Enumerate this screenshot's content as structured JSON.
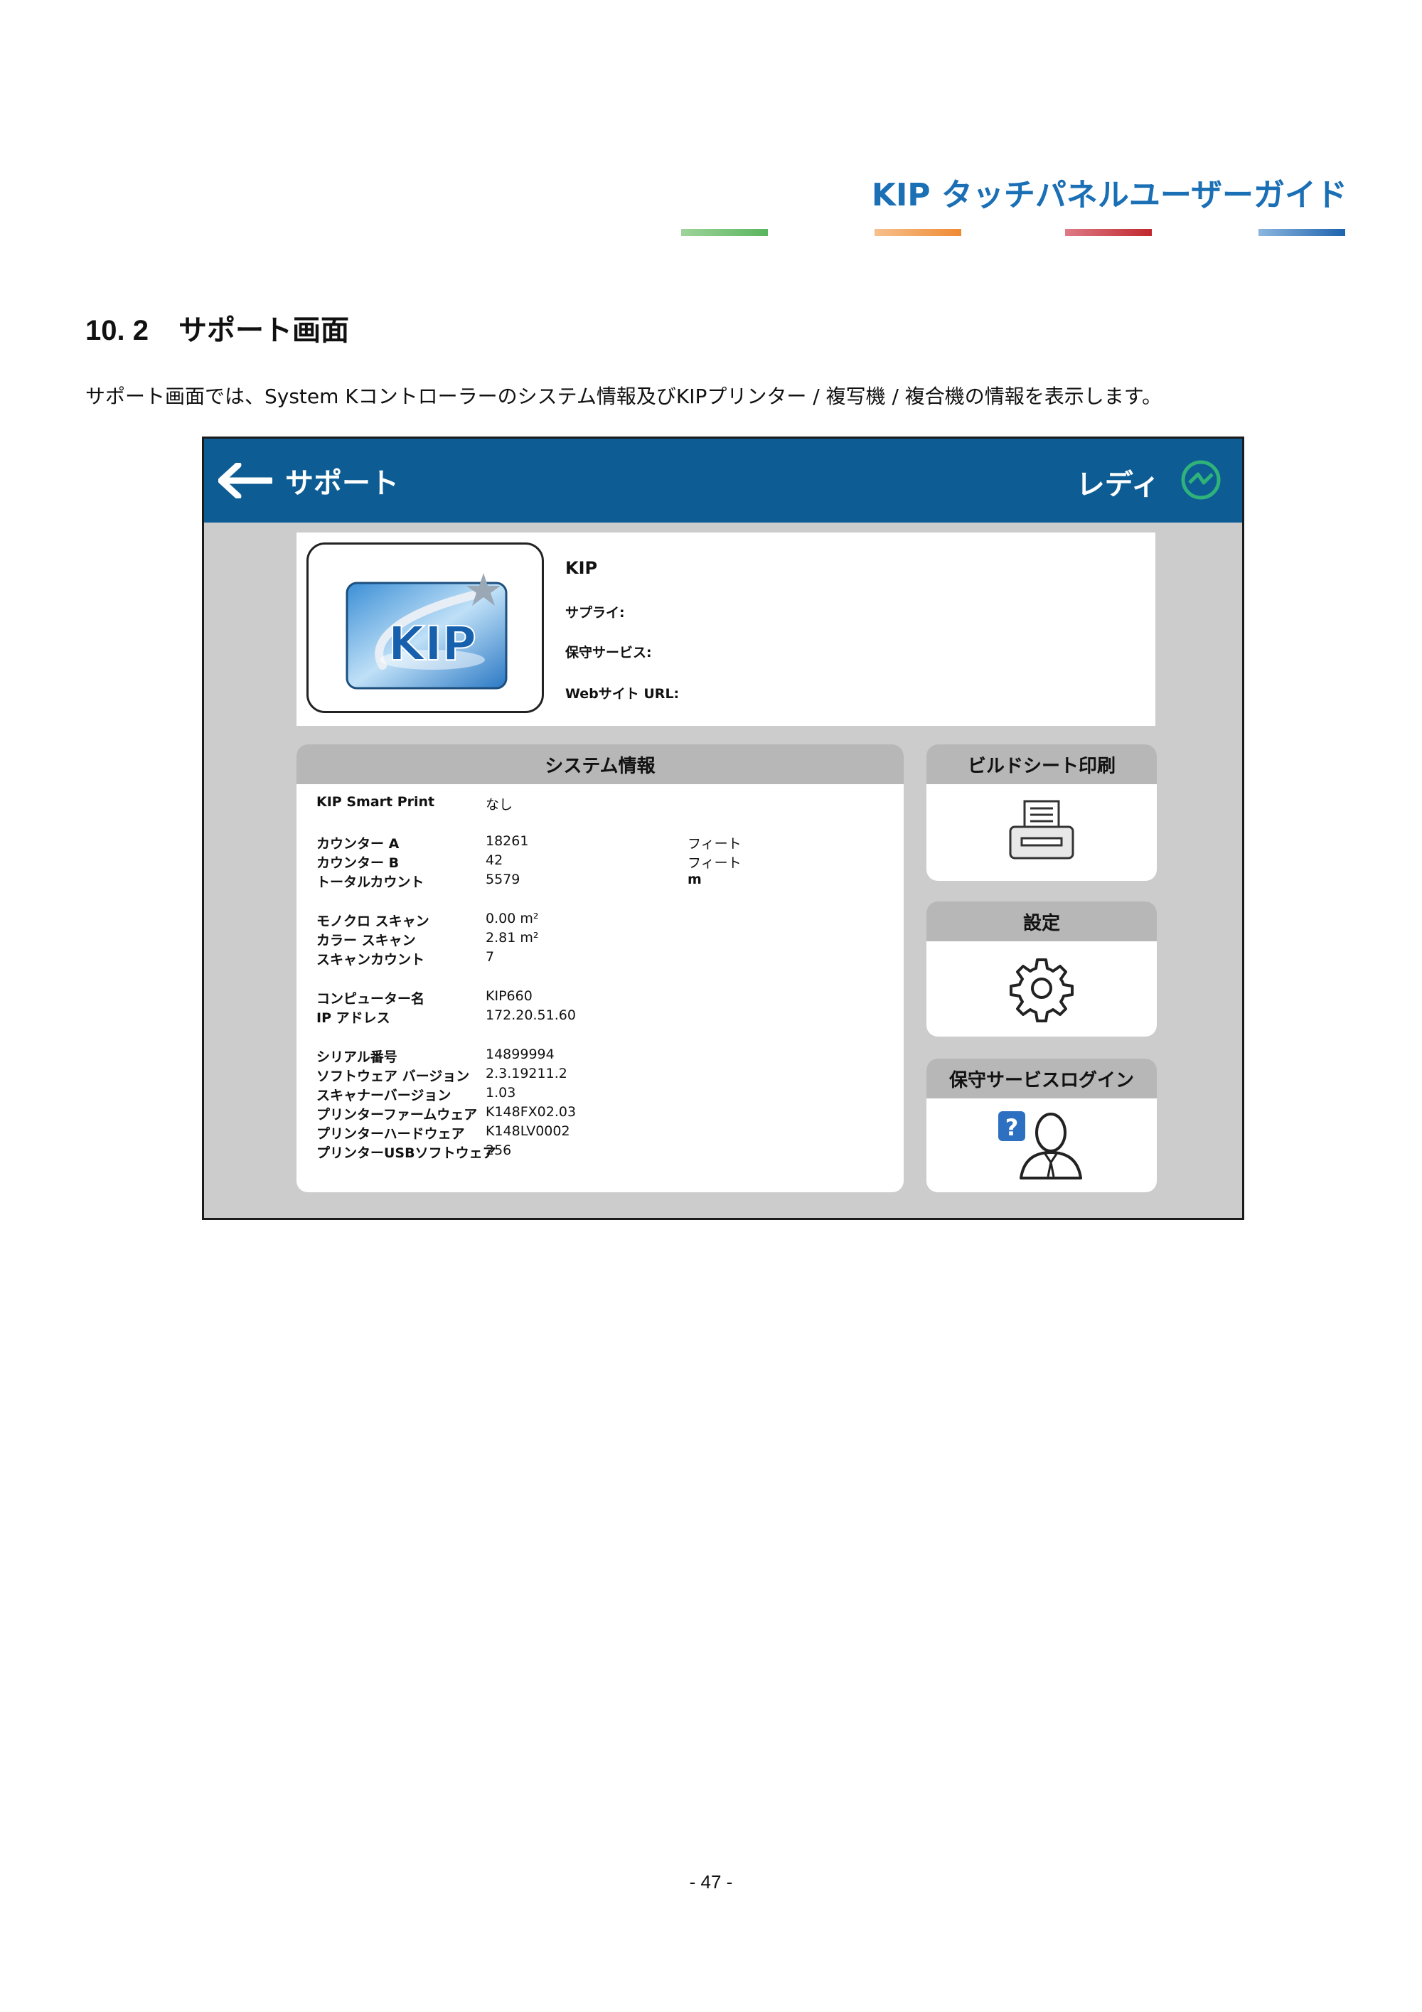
{
  "doc": {
    "title": "KIP タッチパネルユーザーガイド",
    "section_number": "10. 2",
    "section_title": "サポート画面",
    "intro": "サポート画面では、System Kコントローラーのシステム情報及びKIPプリンター / 複写機 / 複合機の情報を表示します。",
    "page_number": "- 47 -"
  },
  "screen": {
    "title": "サポート",
    "status": "レディ",
    "info": {
      "logo_text": "KIP",
      "name": "KIP",
      "supply_label": "サプライ:",
      "service_label": "保守サービス:",
      "website_label": "Webサイト URL:"
    },
    "system_info": {
      "header": "システム情報",
      "rows": [
        {
          "label": "KIP Smart Print",
          "value": "なし",
          "unit": ""
        },
        {
          "label": "カウンター A",
          "value": "18261",
          "unit": "フィート"
        },
        {
          "label": "カウンター B",
          "value": "42",
          "unit": "フィート"
        },
        {
          "label": "トータルカウント",
          "value": "5579",
          "unit": "m"
        },
        {
          "label": "モノクロ スキャン",
          "value": "0.00 m²",
          "unit": ""
        },
        {
          "label": "カラー スキャン",
          "value": "2.81 m²",
          "unit": ""
        },
        {
          "label": "スキャンカウント",
          "value": "7",
          "unit": ""
        },
        {
          "label": "コンピューター名",
          "value": "KIP660",
          "unit": ""
        },
        {
          "label": "IP アドレス",
          "value": "172.20.51.60",
          "unit": ""
        },
        {
          "label": "シリアル番号",
          "value": "14899994",
          "unit": ""
        },
        {
          "label": "ソフトウェア バージョン",
          "value": "2.3.19211.2",
          "unit": ""
        },
        {
          "label": "スキャナーバージョン",
          "value": "1.03",
          "unit": ""
        },
        {
          "label": "プリンターファームウェア",
          "value": "K148FX02.03",
          "unit": ""
        },
        {
          "label": "プリンターハードウェア",
          "value": "K148LV0002",
          "unit": ""
        },
        {
          "label": "プリンターUSBソフトウェア",
          "value": "256",
          "unit": ""
        }
      ]
    },
    "buttons": {
      "build_sheet": "ビルドシート印刷",
      "settings": "設定",
      "service_login": "保守サービスログイン"
    }
  },
  "colors": {
    "title_blue": "#1a6fb5",
    "topbar_blue": "#0d5d94",
    "status_green": "#2fb37a",
    "panel_gray": "#cccccc",
    "header_gray": "#b7b7b7"
  }
}
